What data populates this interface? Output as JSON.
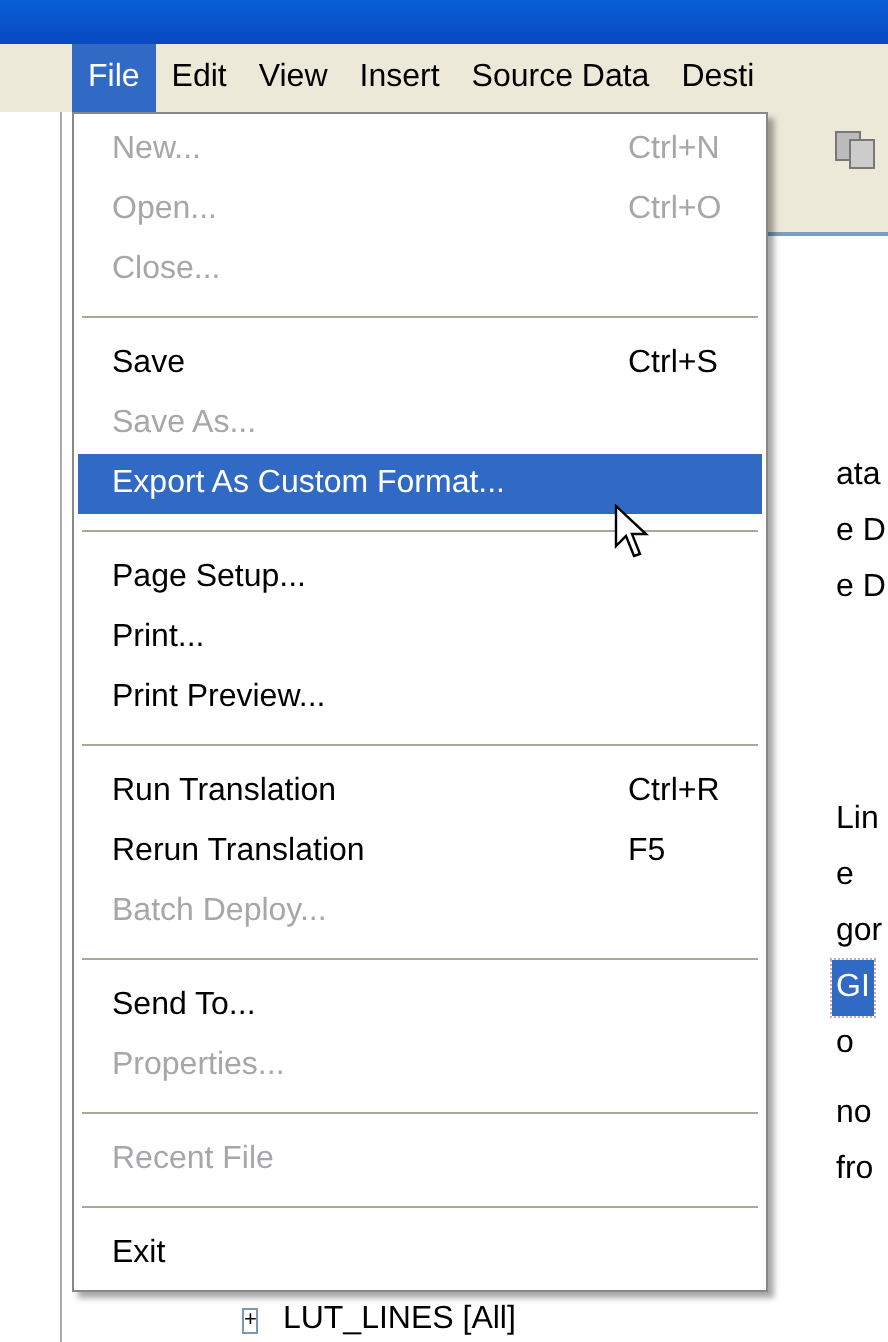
{
  "menu_bar": [
    {
      "label": "File",
      "selected": true
    },
    {
      "label": "Edit",
      "selected": false
    },
    {
      "label": "View",
      "selected": false
    },
    {
      "label": "Insert",
      "selected": false
    },
    {
      "label": "Source Data",
      "selected": false
    },
    {
      "label": "Desti",
      "selected": false
    }
  ],
  "file_menu": [
    [
      {
        "label": "New...",
        "shortcut": "Ctrl+N",
        "disabled": true,
        "selected": false
      },
      {
        "label": "Open...",
        "shortcut": "Ctrl+O",
        "disabled": true,
        "selected": false
      },
      {
        "label": "Close...",
        "disabled": true,
        "selected": false
      }
    ],
    [
      {
        "label": "Save",
        "shortcut": "Ctrl+S",
        "disabled": false,
        "selected": false
      },
      {
        "label": "Save As...",
        "disabled": true,
        "selected": false
      },
      {
        "label": "Export As Custom Format...",
        "disabled": false,
        "selected": true
      }
    ],
    [
      {
        "label": "Page Setup...",
        "disabled": false,
        "selected": false
      },
      {
        "label": "Print...",
        "disabled": false,
        "selected": false
      },
      {
        "label": "Print Preview...",
        "disabled": false,
        "selected": false
      }
    ],
    [
      {
        "label": "Run Translation",
        "shortcut": "Ctrl+R",
        "disabled": false,
        "selected": false
      },
      {
        "label": "Rerun Translation",
        "shortcut": "F5",
        "disabled": false,
        "selected": false
      },
      {
        "label": "Batch Deploy...",
        "disabled": true,
        "selected": false
      }
    ],
    [
      {
        "label": "Send To...",
        "disabled": false,
        "selected": false
      },
      {
        "label": "Properties...",
        "disabled": true,
        "selected": false
      }
    ],
    [
      {
        "label": "Recent File",
        "disabled": true,
        "selected": false
      }
    ],
    [
      {
        "label": "Exit",
        "disabled": false,
        "selected": false
      }
    ]
  ],
  "background_tree": [
    {
      "text": "ata",
      "selected": false
    },
    {
      "text": "e D",
      "selected": false
    },
    {
      "text": "e D",
      "selected": false
    },
    {
      "text": "Lin",
      "selected": false
    },
    {
      "text": "e",
      "selected": false
    },
    {
      "text": "gor",
      "selected": false
    },
    {
      "text": "GI",
      "selected": true
    },
    {
      "text": "o",
      "selected": false
    },
    {
      "text": "no",
      "selected": false
    },
    {
      "text": "fro",
      "selected": false
    }
  ],
  "bottom_tree_row": {
    "expander": "+",
    "label": "LUT_LINES [All]"
  }
}
